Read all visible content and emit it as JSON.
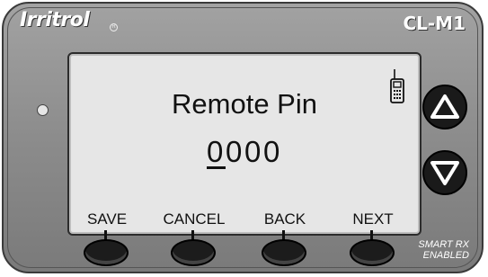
{
  "brand": {
    "logo_text": "Irritrol",
    "model": "CL-M1"
  },
  "screen": {
    "title": "Remote Pin",
    "pin_digits": [
      "0",
      "0",
      "0",
      "0"
    ],
    "active_digit_index": 0,
    "status_icon": "remote-handset-icon"
  },
  "softkeys": [
    {
      "label": "SAVE"
    },
    {
      "label": "CANCEL"
    },
    {
      "label": "BACK"
    },
    {
      "label": "NEXT"
    }
  ],
  "nav_buttons": {
    "up_icon": "up-arrow-icon",
    "down_icon": "down-arrow-icon"
  },
  "badge": {
    "line1": "SMART RX",
    "line2": "ENABLED"
  },
  "colors": {
    "body": "#8c8c8c",
    "screen": "#e6e6e6",
    "button": "#1a1a1a",
    "text_light": "#ffffff"
  }
}
